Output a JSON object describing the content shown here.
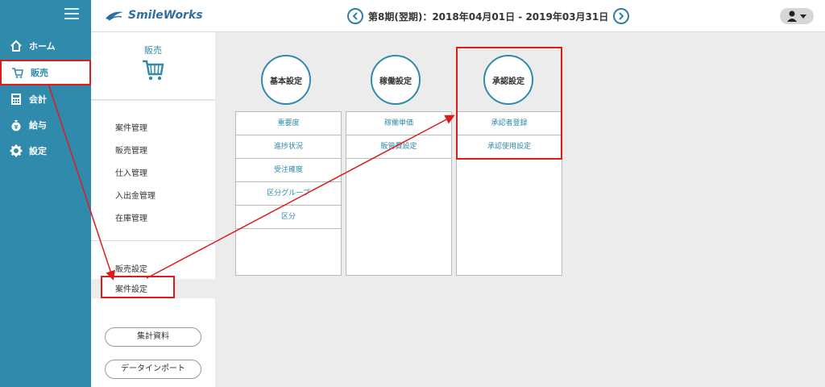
{
  "sidebar": {
    "items": [
      {
        "label": "ホーム",
        "icon": "home-icon"
      },
      {
        "label": "販売",
        "icon": "cart-icon"
      },
      {
        "label": "会計",
        "icon": "calculator-icon"
      },
      {
        "label": "給与",
        "icon": "money-bag-icon"
      },
      {
        "label": "設定",
        "icon": "gear-icon"
      }
    ]
  },
  "header": {
    "logo": "SmileWorks",
    "period": "第8期(翌期)：2018年04月01日 - 2019年03月31日"
  },
  "subpanel": {
    "title": "販売",
    "links": [
      "案件管理",
      "販売管理",
      "仕入管理",
      "入出金管理",
      "在庫管理"
    ],
    "settings": "販売設定",
    "case_setting": "案件設定",
    "buttons": [
      "集計資料",
      "データインポート"
    ]
  },
  "main": {
    "columns": [
      {
        "title": "基本設定",
        "items": [
          "重要度",
          "進捗状況",
          "受注確度",
          "区分グループ",
          "区分"
        ]
      },
      {
        "title": "稼働設定",
        "items": [
          "稼働単価",
          "販管費設定"
        ]
      },
      {
        "title": "承認設定",
        "items": [
          "承認者登録",
          "承認使用設定"
        ]
      }
    ]
  },
  "colors": {
    "sidebar": "#2f8aab",
    "highlight": "#e01a1a",
    "accent": "#2f7fa8"
  }
}
